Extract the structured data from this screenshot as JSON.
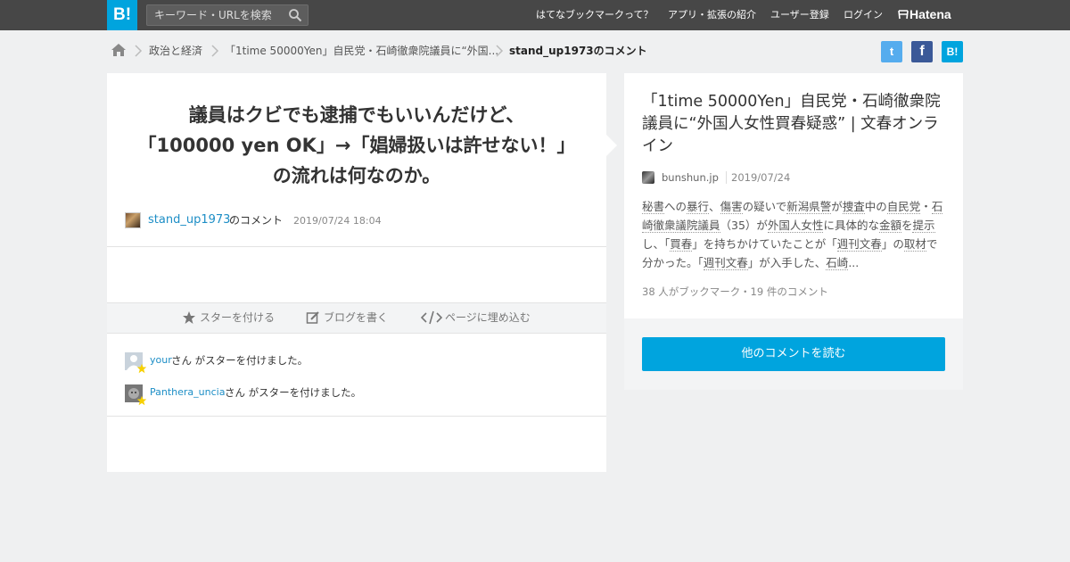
{
  "header": {
    "logo_text": "B!",
    "search_placeholder": "キーワード・URLを検索",
    "nav": [
      "はてなブックマークって？",
      "アプリ・拡張の紹介",
      "ユーザー登録",
      "ログイン"
    ],
    "brand": "Hatena"
  },
  "breadcrumb": {
    "items": [
      "政治と経済",
      "「1time 50000Yen」自民党・石崎徹衆院議員に“外国...",
      "stand_up1973のコメント"
    ]
  },
  "share": {
    "twitter": "t",
    "facebook": "f",
    "hatebu": "B!"
  },
  "comment": {
    "lines": [
      "議員はクビでも逮捕でもいいんだけど、",
      "「100000 yen OK」→「娼婦扱いは許せない！」",
      "の流れは何なのか。"
    ],
    "user": "stand_up1973",
    "suffix": "のコメント",
    "date": "2019/07/24 18:04"
  },
  "actions": {
    "star": "スターを付ける",
    "blog": "ブログを書く",
    "embed": "ページに埋め込む"
  },
  "stars": [
    {
      "user": "your",
      "message": "さん がスターを付けました。"
    },
    {
      "user": "Panthera_uncia",
      "message": "さん がスターを付けました。"
    }
  ],
  "entry": {
    "title": "「1time 50000Yen」自民党・石崎徹衆院議員に“外国人女性買春疑惑” | 文春オンライン",
    "domain": "bunshun.jp",
    "date": "2019/07/24",
    "summary_parts": [
      {
        "t": "秘書",
        "u": true
      },
      {
        "t": "への",
        "u": false
      },
      {
        "t": "暴行",
        "u": true
      },
      {
        "t": "、",
        "u": false
      },
      {
        "t": "傷害",
        "u": true
      },
      {
        "t": "の疑いで",
        "u": false
      },
      {
        "t": "新潟県警",
        "u": true
      },
      {
        "t": "が",
        "u": false
      },
      {
        "t": "捜査",
        "u": true
      },
      {
        "t": "中の",
        "u": false
      },
      {
        "t": "自民党",
        "u": true
      },
      {
        "t": "・",
        "u": false
      },
      {
        "t": "石崎徹衆議院議員",
        "u": true
      },
      {
        "t": "（35）が",
        "u": false
      },
      {
        "t": "外国人女性",
        "u": true
      },
      {
        "t": "に具体的な",
        "u": false
      },
      {
        "t": "金額",
        "u": true
      },
      {
        "t": "を",
        "u": false
      },
      {
        "t": "提示",
        "u": true
      },
      {
        "t": "し、「",
        "u": false
      },
      {
        "t": "買春",
        "u": true
      },
      {
        "t": "」を持ちかけていたことが「",
        "u": false
      },
      {
        "t": "週刊文春",
        "u": true
      },
      {
        "t": "」の",
        "u": false
      },
      {
        "t": "取材",
        "u": true
      },
      {
        "t": "で分かった。「",
        "u": false
      },
      {
        "t": "週刊文春",
        "u": true
      },
      {
        "t": "」が入手した、",
        "u": false
      },
      {
        "t": "石崎",
        "u": true
      },
      {
        "t": "...",
        "u": false
      }
    ],
    "meta": "38 人がブックマーク・19 件のコメント",
    "read_more": "他のコメントを読む"
  },
  "colors": {
    "accent": "#00a4de",
    "topbar": "#474747",
    "link": "#1d8ec6",
    "star": "#f7d000"
  }
}
